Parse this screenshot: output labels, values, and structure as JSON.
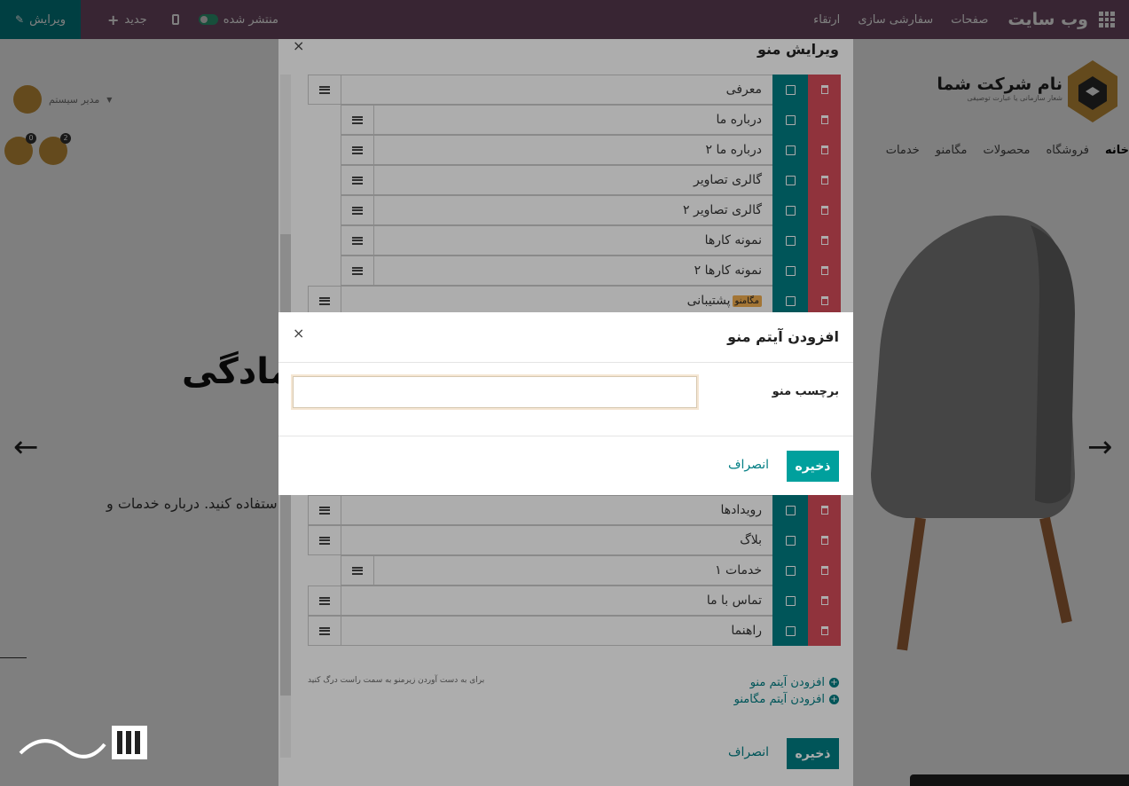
{
  "topbar": {
    "brand": "وب سایت",
    "menu": [
      "صفحات",
      "سفارشی سازی",
      "ارتقاء"
    ],
    "published_label": "منتشر شده",
    "new_label": "جدید",
    "edit_label": "ویرایش"
  },
  "site": {
    "company_name": "نام شرکت شما",
    "company_tagline": "شعار سازمانی یا عبارت توصیفی",
    "admin_name": "مدیر سیستم",
    "nav": [
      "خانه",
      "فروشگاه",
      "محصولات",
      "مگامنو",
      "خدمات"
    ],
    "wishlist_count": "0",
    "cart_count": "2",
    "hero_title": "...مادگی",
    "hero_subtitle": ". استفاده کنید. درباره خدمات و"
  },
  "edit_menu": {
    "title": "ویرایش منو",
    "items": [
      {
        "label": "معرفی",
        "level": 0
      },
      {
        "label": "درباره ما",
        "level": 1
      },
      {
        "label": "درباره ما ۲",
        "level": 1
      },
      {
        "label": "گالری تصاویر",
        "level": 1
      },
      {
        "label": "گالری تصاویر ۲",
        "level": 1
      },
      {
        "label": "نمونه کارها",
        "level": 1
      },
      {
        "label": "نمونه کارها ۲",
        "level": 1
      },
      {
        "label": "پشتیبانی",
        "level": 0,
        "tag": "مگامنو"
      },
      {
        "label": "رویدادها",
        "level": 0
      },
      {
        "label": "بلاگ",
        "level": 0
      },
      {
        "label": "خدمات ۱",
        "level": 1
      },
      {
        "label": "تماس با ما",
        "level": 0
      },
      {
        "label": "راهنما",
        "level": 0
      }
    ],
    "hint": "برای به دست آوردن زیرمنو به سمت راست درگ کنید",
    "add_item": "افزودن آیتم منو",
    "add_mega": "افزودن آیتم مگامنو",
    "save": "ذخیره",
    "cancel": "انصراف"
  },
  "add_dialog": {
    "title": "افزودن آیتم منو",
    "field_label": "برچسب منو",
    "field_value": "",
    "save": "ذخیره",
    "cancel": "انصراف"
  },
  "colors": {
    "topbar": "#714b67",
    "primary": "#017e84",
    "danger": "#d44c59",
    "accent": "#c8953b"
  }
}
